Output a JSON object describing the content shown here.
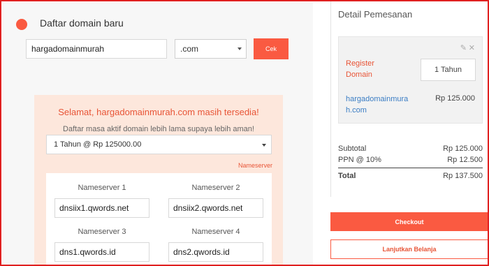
{
  "step": {
    "title": "Daftar domain baru"
  },
  "search": {
    "domain_value": "hargadomainmurah",
    "tld_selected": ".com",
    "check_label": "Cek"
  },
  "availability": {
    "message": "Selamat, hargadomainmurah.com masih tersedia!",
    "subtitle": "Daftar masa aktif domain lebih lama supaya lebih aman!",
    "period_selected": "1 Tahun @ Rp 125000.00",
    "nameserver_link": "Nameserver"
  },
  "nameservers": [
    {
      "label": "Nameserver 1",
      "value": "dnsiix1.qwords.net"
    },
    {
      "label": "Nameserver 2",
      "value": "dnsiix2.qwords.net"
    },
    {
      "label": "Nameserver 3",
      "value": "dns1.qwords.id"
    },
    {
      "label": "Nameserver 4",
      "value": "dns2.qwords.id"
    }
  ],
  "order": {
    "title": "Detail Pemesanan",
    "item_type": "Register Domain",
    "period": "1 Tahun",
    "domain": "hargadomainmurah.com",
    "price": "Rp 125.000",
    "icons": {
      "edit": "edit-icon",
      "close": "close-icon"
    }
  },
  "totals": {
    "subtotal_label": "Subtotal",
    "subtotal_value": "Rp 125.000",
    "tax_label": "PPN @ 10%",
    "tax_value": "Rp 12.500",
    "total_label": "Total",
    "total_value": "Rp 137.500"
  },
  "actions": {
    "checkout_label": "Checkout",
    "continue_label": "Lanjutkan Belanja"
  },
  "colors": {
    "accent": "#fa5a41",
    "panel_bg": "#fde7dc",
    "link": "#3b7dc4",
    "frame_border": "#e02020"
  }
}
